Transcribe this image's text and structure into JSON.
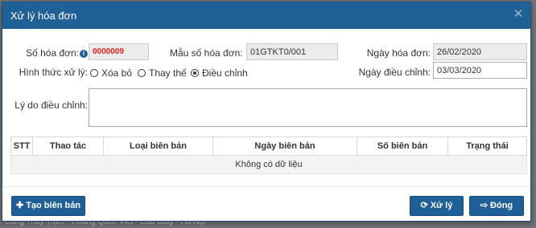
{
  "background": {
    "footer_text": "Cảng Thủy Trạm - Hoàng Quốc Việt - Cầu Giấy - Hà Nội"
  },
  "dialog": {
    "title": "Xử lý hóa đơn",
    "close_icon": "close-icon"
  },
  "form": {
    "invoice_number_label": "Số hóa đơn:",
    "invoice_number_value": "0000009",
    "template_label": "Mẫu số hóa đơn:",
    "template_value": "01GTKT0/001",
    "invoice_date_label": "Ngày hóa đơn:",
    "invoice_date_value": "26/02/2020",
    "process_type_label": "Hình thức xử lý:",
    "options": [
      {
        "label": "Xóa bỏ",
        "checked": false
      },
      {
        "label": "Thay thế",
        "checked": false
      },
      {
        "label": "Điều chỉnh",
        "checked": true
      }
    ],
    "adjust_date_label": "Ngày điều chỉnh:",
    "adjust_date_value": "03/03/2020",
    "reason_label": "Lý do điều chỉnh:",
    "reason_value": ""
  },
  "table": {
    "columns": [
      "STT",
      "Thao tác",
      "Loại biên bản",
      "Ngày biên bản",
      "Số biên bản",
      "Trạng thái"
    ],
    "empty_text": "Không có dữ liệu"
  },
  "buttons": {
    "create_label": "Tạo biên bản",
    "process_label": "Xử lý",
    "close_label": "Đóng"
  },
  "colors": {
    "header": "#1f6096",
    "button": "#1f5f97",
    "invoice_number": "#e0201a"
  }
}
